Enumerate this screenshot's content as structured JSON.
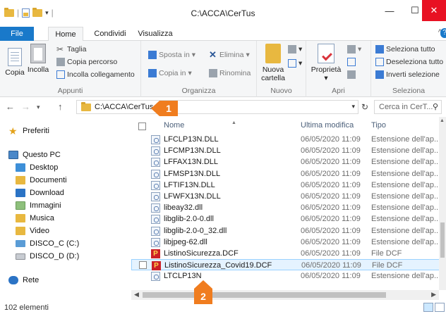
{
  "window": {
    "title": "C:\\ACCA\\CerTus"
  },
  "tabs": [
    {
      "label": "File"
    },
    {
      "label": "Home"
    },
    {
      "label": "Condividi"
    },
    {
      "label": "Visualizza"
    }
  ],
  "ribbon": {
    "clipboard": {
      "copy": "Copia",
      "paste": "Incolla",
      "cut": "Taglia",
      "copy_path": "Copia percorso",
      "paste_link": "Incolla collegamento",
      "label": "Appunti"
    },
    "organize": {
      "move_to": "Sposta in",
      "copy_to": "Copia in",
      "delete": "Elimina",
      "rename": "Rinomina",
      "label": "Organizza"
    },
    "new": {
      "new_folder_line1": "Nuova",
      "new_folder_line2": "cartella",
      "label": "Nuovo"
    },
    "open": {
      "properties": "Proprietà",
      "label": "Apri"
    },
    "select": {
      "select_all": "Seleziona tutto",
      "deselect_all": "Deseleziona tutto",
      "invert": "Inverti selezione",
      "label": "Seleziona"
    }
  },
  "address": {
    "path": "C:\\ACCA\\CerTus",
    "search_placeholder": "Cerca in CerT..."
  },
  "nav": {
    "favorites": "Preferiti",
    "this_pc": "Questo PC",
    "items": [
      "Desktop",
      "Documenti",
      "Download",
      "Immagini",
      "Musica",
      "Video",
      "DISCO_C (C:)",
      "DISCO_D (D:)"
    ],
    "network": "Rete"
  },
  "columns": {
    "name": "Nome",
    "date": "Ultima modifica",
    "type": "Tipo"
  },
  "files": [
    {
      "name": "LFCLP13N.DLL",
      "date": "06/05/2020 11:09",
      "type": "Estensione dell'ap...",
      "kind": "dll"
    },
    {
      "name": "LFCMP13N.DLL",
      "date": "06/05/2020 11:09",
      "type": "Estensione dell'ap...",
      "kind": "dll"
    },
    {
      "name": "LFFAX13N.DLL",
      "date": "06/05/2020 11:09",
      "type": "Estensione dell'ap...",
      "kind": "dll"
    },
    {
      "name": "LFMSP13N.DLL",
      "date": "06/05/2020 11:09",
      "type": "Estensione dell'ap...",
      "kind": "dll"
    },
    {
      "name": "LFTIF13N.DLL",
      "date": "06/05/2020 11:09",
      "type": "Estensione dell'ap...",
      "kind": "dll"
    },
    {
      "name": "LFWFX13N.DLL",
      "date": "06/05/2020 11:09",
      "type": "Estensione dell'ap...",
      "kind": "dll"
    },
    {
      "name": "libeay32.dll",
      "date": "06/05/2020 11:09",
      "type": "Estensione dell'ap...",
      "kind": "dll"
    },
    {
      "name": "libglib-2.0-0.dll",
      "date": "06/05/2020 11:09",
      "type": "Estensione dell'ap...",
      "kind": "dll"
    },
    {
      "name": "libglib-2.0-0_32.dll",
      "date": "06/05/2020 11:09",
      "type": "Estensione dell'ap...",
      "kind": "dll"
    },
    {
      "name": "libjpeg-62.dll",
      "date": "06/05/2020 11:09",
      "type": "Estensione dell'ap...",
      "kind": "dll"
    },
    {
      "name": "ListinoSicurezza.DCF",
      "date": "06/05/2020 11:09",
      "type": "File DCF",
      "kind": "dcf"
    },
    {
      "name": "ListinoSicurezza_Covid19.DCF",
      "date": "06/05/2020 11:09",
      "type": "File DCF",
      "kind": "dcf"
    },
    {
      "name": "LTCLP13N",
      "date": "06/05/2020 11:09",
      "type": "Estensione dell'ap...",
      "kind": "dll"
    }
  ],
  "status": {
    "count": "102 elementi"
  },
  "callouts": [
    "1",
    "2"
  ]
}
